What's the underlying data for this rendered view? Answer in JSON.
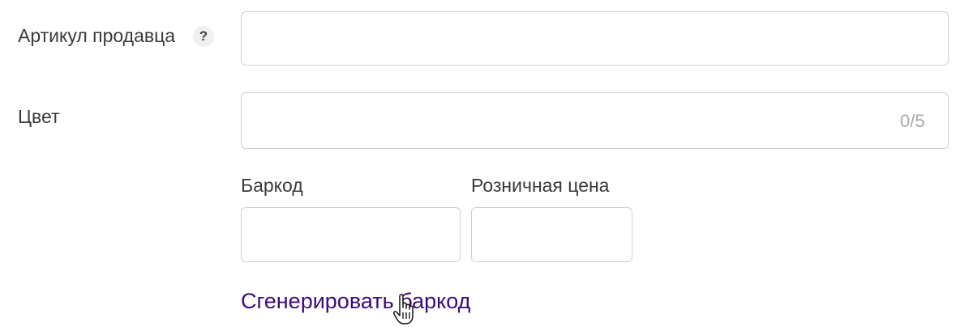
{
  "article": {
    "label": "Артикул продавца",
    "help_glyph": "?",
    "value": ""
  },
  "color": {
    "label": "Цвет",
    "value": "",
    "counter": "0/5"
  },
  "barcode": {
    "label": "Баркод",
    "value": ""
  },
  "retail_price": {
    "label": "Розничная цена",
    "value": ""
  },
  "generate_barcode": {
    "label": "Сгенерировать баркод"
  },
  "icons": {
    "help": "question-mark-icon",
    "cursor": "hand-pointer-cursor-icon"
  },
  "colors": {
    "text": "#3a3a3a",
    "border": "#cfcfcf",
    "link": "#3d0a7a",
    "counter": "#a8a8a8",
    "help_bg": "#f0f0f0"
  }
}
